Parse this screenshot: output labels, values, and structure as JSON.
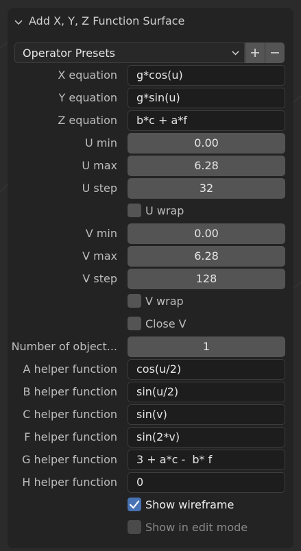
{
  "panel": {
    "title": "Add X, Y, Z Function Surface"
  },
  "presets": {
    "label": "Operator Presets",
    "add_symbol": "+",
    "remove_symbol": "−"
  },
  "equations": {
    "x_label": "X equation",
    "x_value": "g*cos(u)",
    "y_label": "Y equation",
    "y_value": "g*sin(u)",
    "z_label": "Z equation",
    "z_value": "b*c + a*f"
  },
  "u": {
    "min_label": "U min",
    "min_value": "0.00",
    "max_label": "U max",
    "max_value": "6.28",
    "step_label": "U step",
    "step_value": "32",
    "wrap_label": "U wrap",
    "wrap_checked": false
  },
  "v": {
    "min_label": "V min",
    "min_value": "0.00",
    "max_label": "V max",
    "max_value": "6.28",
    "step_label": "V step",
    "step_value": "128",
    "wrap_label": "V wrap",
    "wrap_checked": false,
    "close_label": "Close V",
    "close_checked": false
  },
  "objects": {
    "label": "Number of object...",
    "value": "1"
  },
  "helpers": {
    "a_label": "A helper function",
    "a_value": "cos(u/2)",
    "b_label": "B helper function",
    "b_value": "sin(u/2)",
    "c_label": "C helper function",
    "c_value": "sin(v)",
    "f_label": "F helper function",
    "f_value": "sin(2*v)",
    "g_label": "G helper function",
    "g_value": "3 + a*c -  b* f",
    "h_label": "H helper function",
    "h_value": "0"
  },
  "display": {
    "wireframe_label": "Show wireframe",
    "wireframe_checked": true,
    "editmode_label": "Show in edit mode",
    "editmode_checked": false
  },
  "colors": {
    "panel_bg": "#232323",
    "field_bg": "#545454",
    "text_input_bg": "#1d1d1d",
    "accent": "#4772b3"
  }
}
